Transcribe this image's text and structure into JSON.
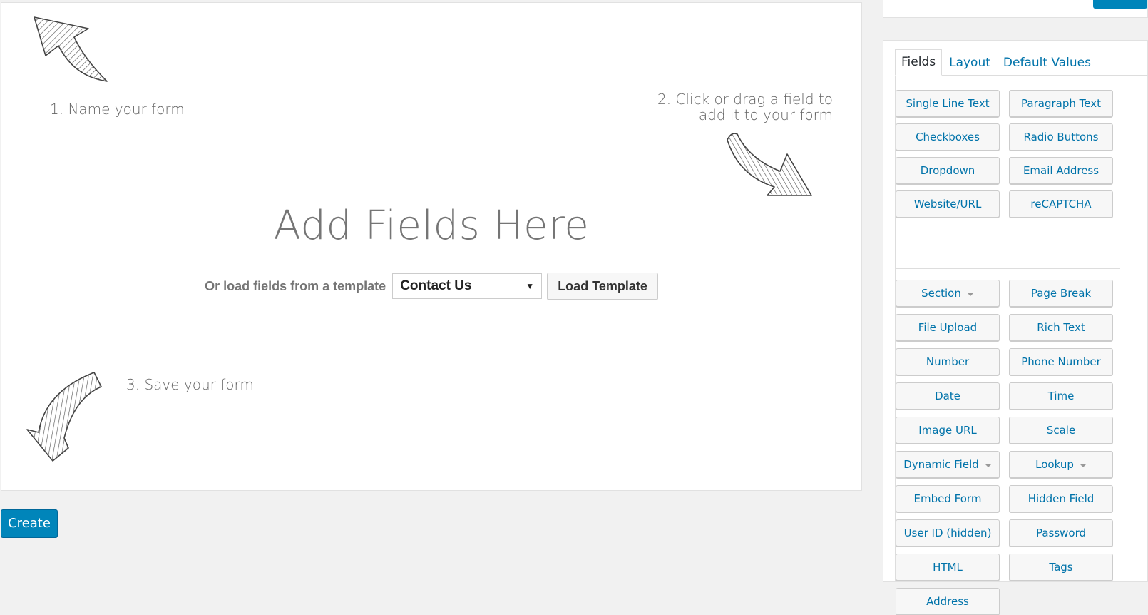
{
  "canvas": {
    "step1": "1. Name your form",
    "step2_line1": "2. Click or drag a field to",
    "step2_line2": "add it to your form",
    "step3": "3. Save your form",
    "heading": "Add Fields Here",
    "template_label": "Or load fields from a template",
    "template_selected": "Contact Us",
    "load_button": "Load Template"
  },
  "create_button": "Create",
  "sidebar": {
    "tabs": [
      "Fields",
      "Layout",
      "Default Values"
    ],
    "basic_fields": [
      "Single Line Text",
      "Paragraph Text",
      "Checkboxes",
      "Radio Buttons",
      "Dropdown",
      "Email Address",
      "Website/URL",
      "reCAPTCHA"
    ],
    "advanced_fields": [
      "Section",
      "Page Break",
      "File Upload",
      "Rich Text",
      "Number",
      "Phone Number",
      "Date",
      "Time",
      "Image URL",
      "Scale",
      "Dynamic Field",
      "Lookup",
      "Embed Form",
      "Hidden Field",
      "User ID (hidden)",
      "Password",
      "HTML",
      "Tags",
      "Address"
    ]
  },
  "colors": {
    "primary": "#0085ba",
    "link": "#0073aa",
    "muted_text": "#757575"
  },
  "icons": {
    "arrow_up_left": "hand-drawn-arrow-icon",
    "arrow_down_right": "hand-drawn-arrow-icon",
    "arrow_down_left": "hand-drawn-arrow-icon",
    "dropdown_caret": "caret-down-icon"
  }
}
